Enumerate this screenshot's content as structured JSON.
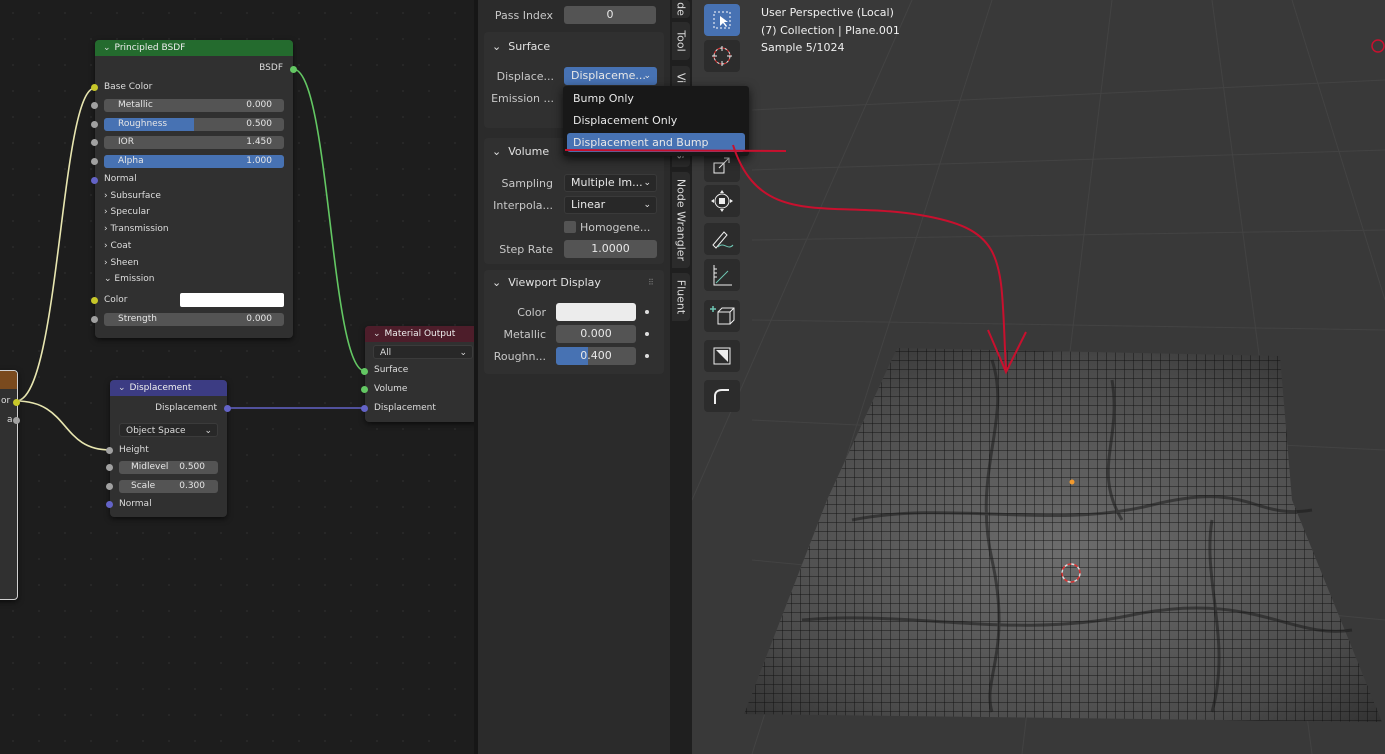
{
  "node_editor": {
    "principled": {
      "title": "Principled BSDF",
      "output": "BSDF",
      "base_color": "Base Color",
      "fields": [
        {
          "label": "Metallic",
          "value": "0.000",
          "fill": 0
        },
        {
          "label": "Roughness",
          "value": "0.500",
          "fill": 0.5
        },
        {
          "label": "IOR",
          "value": "1.450",
          "fill": 0
        },
        {
          "label": "Alpha",
          "value": "1.000",
          "fill": 1
        }
      ],
      "normal": "Normal",
      "panels": [
        "Subsurface",
        "Specular",
        "Transmission",
        "Coat",
        "Sheen"
      ],
      "emission": "Emission",
      "color": "Color",
      "strength_label": "Strength",
      "strength_value": "0.000"
    },
    "displacement": {
      "title": "Displacement",
      "output": "Displacement",
      "space": "Object Space",
      "height": "Height",
      "midlevel_label": "Midlevel",
      "midlevel_value": "0.500",
      "scale_label": "Scale",
      "scale_value": "0.300",
      "normal": "Normal"
    },
    "material_output": {
      "title": "Material Output",
      "target": "All",
      "surface": "Surface",
      "volume": "Volume",
      "displacement": "Displacement"
    },
    "left_node_partial": {
      "or": "or",
      "a": "a"
    }
  },
  "properties": {
    "pass_index_label": "Pass Index",
    "pass_index_value": "0",
    "surface_header": "Surface",
    "displacement_label": "Displace...",
    "displacement_value": "Displaceme...",
    "emission_label": "Emission ...",
    "volume_header": "Volume",
    "sampling_label": "Sampling",
    "sampling_value": "Multiple Im...",
    "interpolation_label": "Interpola...",
    "interpolation_value": "Linear",
    "homogeneous_label": "Homogene...",
    "step_rate_label": "Step Rate",
    "step_rate_value": "1.0000",
    "viewport_display_header": "Viewport Display",
    "vd_color_label": "Color",
    "vd_metallic_label": "Metallic",
    "vd_metallic_value": "0.000",
    "vd_roughness_label": "Roughn...",
    "vd_roughness_value": "0.400",
    "vd_roughness_fill": 0.4
  },
  "dropdown_menu": {
    "items": [
      "Bump Only",
      "Displacement Only",
      "Displacement and Bump"
    ],
    "selected": "Displacement and Bump"
  },
  "side_tabs": [
    "de",
    "Tool",
    "Vi",
    "s",
    "Node Wrangler",
    "Fluent"
  ],
  "viewport": {
    "line1": "User Perspective (Local)",
    "line2": "(7) Collection | Plane.001",
    "line3": "Sample 5/1024"
  },
  "tools": [
    "select-box-icon",
    "cursor-icon",
    "move-icon",
    "scale-icon",
    "transform-icon",
    "annotate-icon",
    "measure-icon",
    "add-cube-icon",
    "bevel-icon",
    "extrude-icon"
  ],
  "colors": {
    "accent": "#4772b3",
    "principled_header": "#246b2e",
    "displacement_header": "#3c3c83",
    "output_header": "#4d1d2a",
    "annotation_red": "#c8102e",
    "socket_yellow": "#c7c729",
    "socket_green": "#63c763",
    "socket_purple": "#6363c7",
    "socket_gray": "#a1a1a1"
  }
}
